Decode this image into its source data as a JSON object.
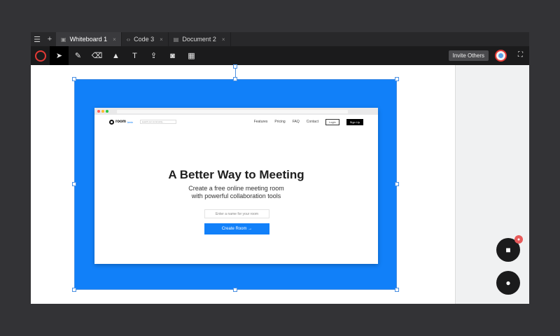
{
  "tabbar": {
    "menu_icon": "☰",
    "add_icon": "+",
    "tabs": [
      {
        "label": "Whiteboard 1",
        "icon": "▣",
        "close": "×"
      },
      {
        "label": "Code 3",
        "icon": "‹›",
        "close": "×"
      },
      {
        "label": "Document 2",
        "icon": "▤",
        "close": "×"
      }
    ]
  },
  "toolbar": {
    "tools": [
      {
        "name": "select-tool-icon",
        "glyph": "➤"
      },
      {
        "name": "pen-tool-icon",
        "glyph": "✎"
      },
      {
        "name": "eraser-tool-icon",
        "glyph": "⌫"
      },
      {
        "name": "shapes-tool-icon",
        "glyph": "▲"
      },
      {
        "name": "text-tool-icon",
        "glyph": "T"
      },
      {
        "name": "upload-tool-icon",
        "glyph": "⇪"
      },
      {
        "name": "camera-tool-icon",
        "glyph": "◙"
      },
      {
        "name": "grid-tool-icon",
        "glyph": "▦"
      }
    ],
    "invite_label": "Invite Others",
    "fullscreen_glyph": "⛶"
  },
  "mock_site": {
    "logo_text": "room",
    "logo_beta": "beta",
    "search_placeholder": "search our community...",
    "nav": [
      "Features",
      "Pricing",
      "FAQ",
      "Contact"
    ],
    "login_label": "Login",
    "signup_label": "Sign Up",
    "hero_title": "A Better Way to Meeting",
    "hero_sub_1": "Create a free online meeting room",
    "hero_sub_2": "with powerful collaboration tools",
    "input_placeholder": "Enter a name for your room",
    "create_label": "Create Room →"
  },
  "fabs": {
    "video_glyph": "■",
    "mic_badge_glyph": "●",
    "chat_glyph": "●"
  },
  "colors": {
    "accent": "#1180f9",
    "record": "#e53935",
    "dark": "#1b1b1c"
  }
}
